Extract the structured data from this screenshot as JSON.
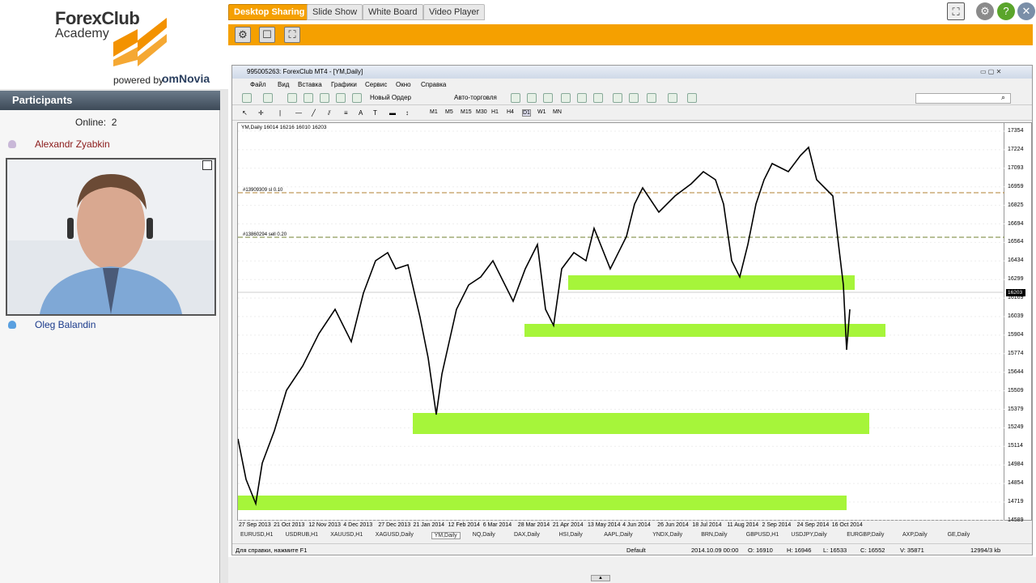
{
  "brand": {
    "name": "ForexClub",
    "sub": "Academy",
    "powered_by": "powered by",
    "partner": "omNovia"
  },
  "participants": {
    "title": "Participants",
    "online_label": "Online:",
    "online_count": "2",
    "people": [
      "Alexandr Zyabkin",
      "Oleg Balandin"
    ]
  },
  "tabs": [
    "Desktop Sharing",
    "Slide Show",
    "White Board",
    "Video Player"
  ],
  "mt4": {
    "title": "995005263: ForexClub MT4 - [YM,Daily]",
    "menu": [
      "Файл",
      "Вид",
      "Вставка",
      "Графики",
      "Сервис",
      "Окно",
      "Справка"
    ],
    "new_order": "Новый Ордер",
    "auto_trade": "Авто-торговля",
    "timeframes": [
      "M1",
      "M5",
      "M15",
      "M30",
      "H1",
      "H4",
      "D1",
      "W1",
      "MN"
    ],
    "chart_label": "YM,Daily  16014 16216 16010 16203",
    "hline1": "#13909309 sl 0.10",
    "hline2": "#13860294 sell 0.20",
    "current_price": "16203",
    "y_ticks": [
      "17354",
      "17224",
      "17093",
      "16959",
      "16825",
      "16694",
      "16564",
      "16434",
      "16299",
      "16169",
      "16039",
      "15904",
      "15774",
      "15644",
      "15509",
      "15379",
      "15249",
      "15114",
      "14984",
      "14854",
      "14719",
      "14589"
    ],
    "x_ticks": [
      "27 Sep 2013",
      "21 Oct 2013",
      "12 Nov 2013",
      "4 Dec 2013",
      "27 Dec 2013",
      "21 Jan 2014",
      "12 Feb 2014",
      "6 Mar 2014",
      "28 Mar 2014",
      "21 Apr 2014",
      "13 May 2014",
      "4 Jun 2014",
      "26 Jun 2014",
      "18 Jul 2014",
      "11 Aug 2014",
      "2 Sep 2014",
      "24 Sep 2014",
      "16 Oct 2014"
    ],
    "symbol_tabs": [
      "EURUSD,H1",
      "USDRUB,H1",
      "XAUUSD,H1",
      "XAGUSD,Daily",
      "YM,Daily",
      "NQ,Daily",
      "DAX,Daily",
      "HSI,Daily",
      "AAPL,Daily",
      "YNDX,Daily",
      "BRN,Daily",
      "GBPUSD,H1",
      "USDJPY,Daily",
      "EURGBP,Daily",
      "AXP,Daily",
      "GE,Daily"
    ],
    "status": {
      "help": "Для справки, нажмите F1",
      "profile": "Default",
      "time": "2014.10.09 00:00",
      "open": "O: 16910",
      "high": "H: 16946",
      "low": "L: 16533",
      "close": "C: 16552",
      "volume": "V: 35871",
      "traffic": "12994/3 kb"
    }
  },
  "colors": {
    "accent": "#f5a000",
    "zone": "#a6f53a"
  }
}
